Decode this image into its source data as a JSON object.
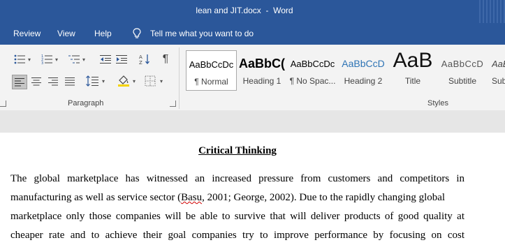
{
  "window": {
    "title": "lean and JIT.docx  -  Word"
  },
  "menu": {
    "tabs": [
      {
        "label": "Review"
      },
      {
        "label": "View"
      },
      {
        "label": "Help"
      }
    ],
    "tell_me": "Tell me what you want to do"
  },
  "ribbon": {
    "paragraph_group_label": "Paragraph",
    "styles_group_label": "Styles",
    "styles": [
      {
        "sample": "AaBbCcDc",
        "name": "¶ Normal",
        "selected": true
      },
      {
        "sample": "AaBbC(",
        "name": "Heading 1"
      },
      {
        "sample": "AaBbCcDc",
        "name": "¶ No Spac..."
      },
      {
        "sample": "AaBbCcD",
        "name": "Heading 2"
      },
      {
        "sample": "AaB",
        "name": "Title"
      },
      {
        "sample": "AaBbCcD",
        "name": "Subtitle"
      },
      {
        "sample": "AaBbCcDd",
        "name": "Sub"
      }
    ],
    "icons": {
      "bullets": "bullet-list-icon",
      "numbering": "numbered-list-icon",
      "multilevel": "multilevel-list-icon",
      "decrease_indent": "decrease-indent-icon",
      "increase_indent": "increase-indent-icon",
      "sort": "sort-az-icon",
      "show_marks": "pilcrow-icon",
      "align_left": "align-left-icon",
      "center": "align-center-icon",
      "align_right": "align-right-icon",
      "justify": "justify-icon",
      "line_spacing": "line-spacing-icon",
      "shading": "shading-icon",
      "borders": "borders-icon"
    }
  },
  "document": {
    "heading": "Critical Thinking",
    "lines": [
      "The global marketplace has witnessed an increased pressure from customers and competitors in",
      "manufacturing as well as service sector (",
      "Basu",
      ", 2001; George, 2002). Due to the rapidly changing global",
      "marketplace only those companies will be able to survive that will deliver products of good quality at",
      "cheaper rate and to achieve their goal companies try to improve performance by focusing on cost"
    ]
  },
  "colors": {
    "brand_blue": "#2b579a",
    "ribbon_bg": "#f3f3f3",
    "heading2_blue": "#2e74b5",
    "spell_error": "#d00000"
  }
}
